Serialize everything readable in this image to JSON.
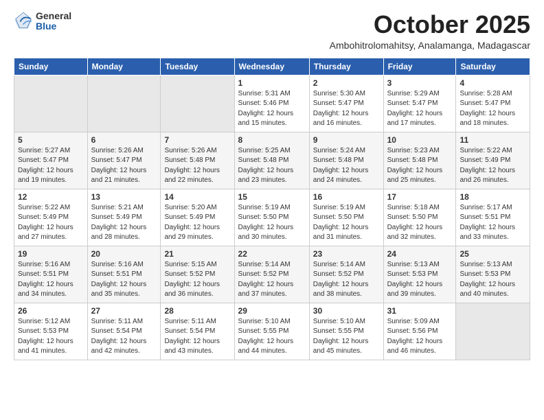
{
  "logo": {
    "general": "General",
    "blue": "Blue"
  },
  "header": {
    "month": "October 2025",
    "location": "Ambohitrolomahitsy, Analamanga, Madagascar"
  },
  "days_of_week": [
    "Sunday",
    "Monday",
    "Tuesday",
    "Wednesday",
    "Thursday",
    "Friday",
    "Saturday"
  ],
  "weeks": [
    [
      {
        "day": "",
        "info": ""
      },
      {
        "day": "",
        "info": ""
      },
      {
        "day": "",
        "info": ""
      },
      {
        "day": "1",
        "info": "Sunrise: 5:31 AM\nSunset: 5:46 PM\nDaylight: 12 hours\nand 15 minutes."
      },
      {
        "day": "2",
        "info": "Sunrise: 5:30 AM\nSunset: 5:47 PM\nDaylight: 12 hours\nand 16 minutes."
      },
      {
        "day": "3",
        "info": "Sunrise: 5:29 AM\nSunset: 5:47 PM\nDaylight: 12 hours\nand 17 minutes."
      },
      {
        "day": "4",
        "info": "Sunrise: 5:28 AM\nSunset: 5:47 PM\nDaylight: 12 hours\nand 18 minutes."
      }
    ],
    [
      {
        "day": "5",
        "info": "Sunrise: 5:27 AM\nSunset: 5:47 PM\nDaylight: 12 hours\nand 19 minutes."
      },
      {
        "day": "6",
        "info": "Sunrise: 5:26 AM\nSunset: 5:47 PM\nDaylight: 12 hours\nand 21 minutes."
      },
      {
        "day": "7",
        "info": "Sunrise: 5:26 AM\nSunset: 5:48 PM\nDaylight: 12 hours\nand 22 minutes."
      },
      {
        "day": "8",
        "info": "Sunrise: 5:25 AM\nSunset: 5:48 PM\nDaylight: 12 hours\nand 23 minutes."
      },
      {
        "day": "9",
        "info": "Sunrise: 5:24 AM\nSunset: 5:48 PM\nDaylight: 12 hours\nand 24 minutes."
      },
      {
        "day": "10",
        "info": "Sunrise: 5:23 AM\nSunset: 5:48 PM\nDaylight: 12 hours\nand 25 minutes."
      },
      {
        "day": "11",
        "info": "Sunrise: 5:22 AM\nSunset: 5:49 PM\nDaylight: 12 hours\nand 26 minutes."
      }
    ],
    [
      {
        "day": "12",
        "info": "Sunrise: 5:22 AM\nSunset: 5:49 PM\nDaylight: 12 hours\nand 27 minutes."
      },
      {
        "day": "13",
        "info": "Sunrise: 5:21 AM\nSunset: 5:49 PM\nDaylight: 12 hours\nand 28 minutes."
      },
      {
        "day": "14",
        "info": "Sunrise: 5:20 AM\nSunset: 5:49 PM\nDaylight: 12 hours\nand 29 minutes."
      },
      {
        "day": "15",
        "info": "Sunrise: 5:19 AM\nSunset: 5:50 PM\nDaylight: 12 hours\nand 30 minutes."
      },
      {
        "day": "16",
        "info": "Sunrise: 5:19 AM\nSunset: 5:50 PM\nDaylight: 12 hours\nand 31 minutes."
      },
      {
        "day": "17",
        "info": "Sunrise: 5:18 AM\nSunset: 5:50 PM\nDaylight: 12 hours\nand 32 minutes."
      },
      {
        "day": "18",
        "info": "Sunrise: 5:17 AM\nSunset: 5:51 PM\nDaylight: 12 hours\nand 33 minutes."
      }
    ],
    [
      {
        "day": "19",
        "info": "Sunrise: 5:16 AM\nSunset: 5:51 PM\nDaylight: 12 hours\nand 34 minutes."
      },
      {
        "day": "20",
        "info": "Sunrise: 5:16 AM\nSunset: 5:51 PM\nDaylight: 12 hours\nand 35 minutes."
      },
      {
        "day": "21",
        "info": "Sunrise: 5:15 AM\nSunset: 5:52 PM\nDaylight: 12 hours\nand 36 minutes."
      },
      {
        "day": "22",
        "info": "Sunrise: 5:14 AM\nSunset: 5:52 PM\nDaylight: 12 hours\nand 37 minutes."
      },
      {
        "day": "23",
        "info": "Sunrise: 5:14 AM\nSunset: 5:52 PM\nDaylight: 12 hours\nand 38 minutes."
      },
      {
        "day": "24",
        "info": "Sunrise: 5:13 AM\nSunset: 5:53 PM\nDaylight: 12 hours\nand 39 minutes."
      },
      {
        "day": "25",
        "info": "Sunrise: 5:13 AM\nSunset: 5:53 PM\nDaylight: 12 hours\nand 40 minutes."
      }
    ],
    [
      {
        "day": "26",
        "info": "Sunrise: 5:12 AM\nSunset: 5:53 PM\nDaylight: 12 hours\nand 41 minutes."
      },
      {
        "day": "27",
        "info": "Sunrise: 5:11 AM\nSunset: 5:54 PM\nDaylight: 12 hours\nand 42 minutes."
      },
      {
        "day": "28",
        "info": "Sunrise: 5:11 AM\nSunset: 5:54 PM\nDaylight: 12 hours\nand 43 minutes."
      },
      {
        "day": "29",
        "info": "Sunrise: 5:10 AM\nSunset: 5:55 PM\nDaylight: 12 hours\nand 44 minutes."
      },
      {
        "day": "30",
        "info": "Sunrise: 5:10 AM\nSunset: 5:55 PM\nDaylight: 12 hours\nand 45 minutes."
      },
      {
        "day": "31",
        "info": "Sunrise: 5:09 AM\nSunset: 5:56 PM\nDaylight: 12 hours\nand 46 minutes."
      },
      {
        "day": "",
        "info": ""
      }
    ]
  ]
}
